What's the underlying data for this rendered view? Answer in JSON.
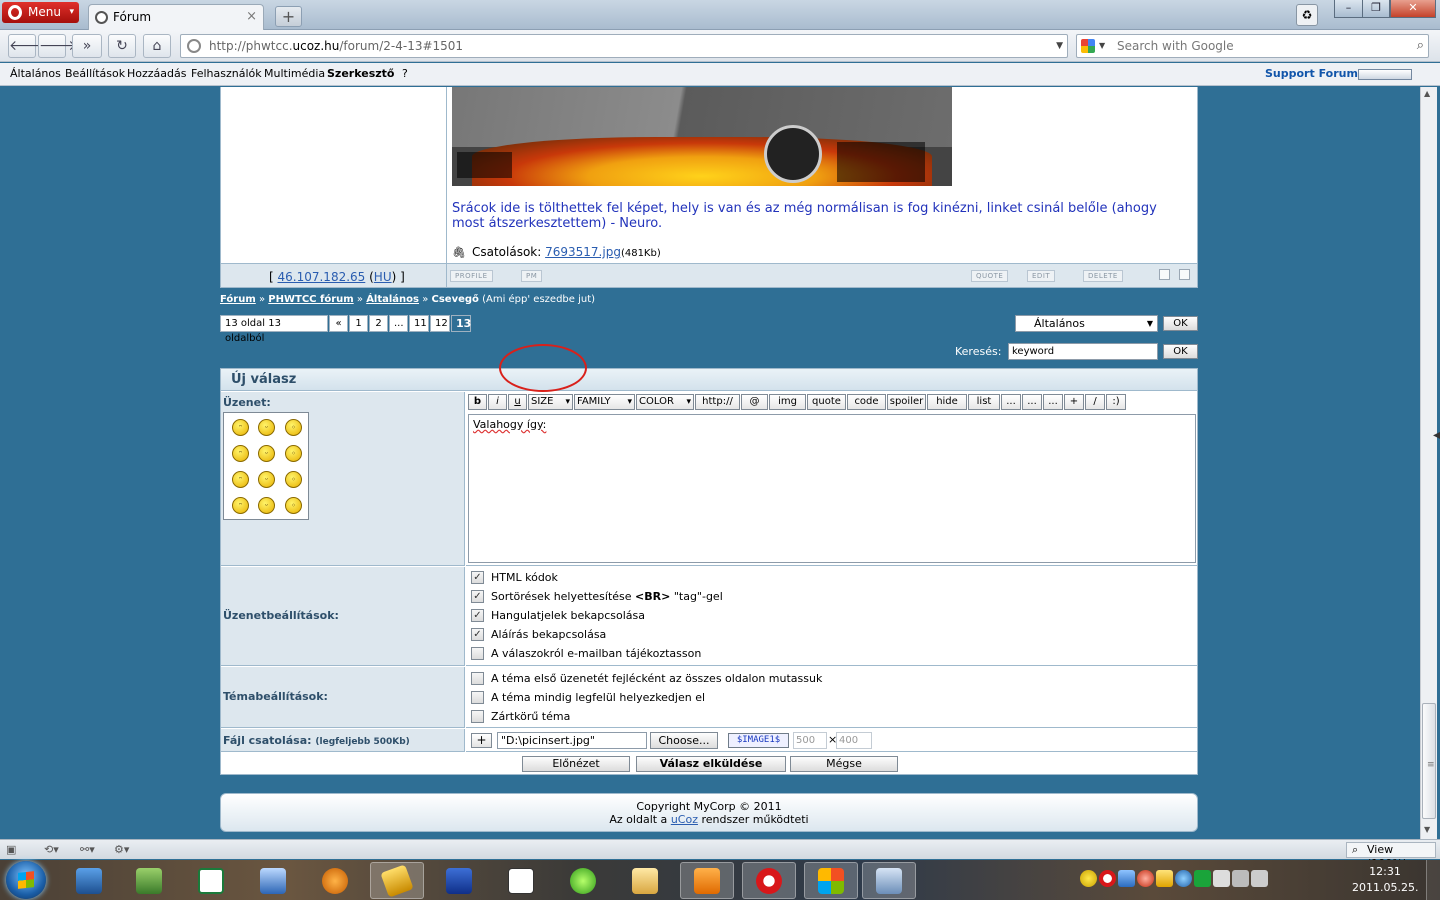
{
  "browser": {
    "menu_label": "Menu",
    "tab_title": "Fórum",
    "tab_close": "×",
    "new_tab": "+",
    "address_prefix": "http://phwtcc.",
    "address_domain": "ucoz.hu",
    "address_path": "/forum/2-4-13#1501",
    "search_placeholder": "Search with Google",
    "bookmarks": [
      "Általános",
      "Beállítások",
      "Hozzáadás",
      "Felhasználók",
      "Multimédia",
      "Szerkesztő",
      "?"
    ],
    "support_link": "Support Forum",
    "zoom": "View (100%)"
  },
  "post": {
    "text": "Srácok ide is tölthettek fel képet, hely is van és az még normálisan is fog kinézni, linket csinál belőle (ahogy most átszerkesztettem) - Neuro.",
    "attach_label": "Csatolások:",
    "attach_file": "7693517.jpg",
    "attach_size": "(481Kb)",
    "ip_open": "[ ",
    "ip": "46.107.182.65",
    "ip_country": "HU",
    "ip_close": " ]",
    "buttons": {
      "profile": "PROFILE",
      "pm": "PM",
      "quote": "QUOTE",
      "edit": "EDIT",
      "delete": "DELETE"
    }
  },
  "breadcrumb": {
    "forum": "Fórum",
    "section": "PHWTCC fórum",
    "category": "Általános",
    "topic": "Csevegő",
    "topic_desc": "(Ami épp' eszedbe jut)",
    "sep": "»"
  },
  "pager": {
    "summary": "13 oldal 13 oldalból",
    "prev": "«",
    "pages": [
      "1",
      "2",
      "...",
      "11",
      "12"
    ],
    "current": "13"
  },
  "jump": {
    "selected": "Általános",
    "ok": "OK"
  },
  "search": {
    "label": "Keresés:",
    "value": "keyword",
    "ok": "OK"
  },
  "reply": {
    "title": "Új válasz",
    "message_label": "Üzenet:",
    "toolbar": [
      "b",
      "i",
      "u",
      "SIZE",
      "FAMILY",
      "COLOR",
      "http://",
      "@",
      "img",
      "quote",
      "code",
      "spoiler",
      "hide",
      "list",
      "...",
      "...",
      "...",
      "+",
      "/",
      ":)"
    ],
    "message_text": "Valahogy így:",
    "settings_label": "Üzenetbeállítások:",
    "settings": [
      {
        "label_pre": "HTML kódok",
        "label_bold": "",
        "label_post": "",
        "checked": true
      },
      {
        "label_pre": "Sortörések helyettesítése ",
        "label_bold": "<BR>",
        "label_post": " \"tag\"-gel",
        "checked": true
      },
      {
        "label_pre": "Hangulatjelek bekapcsolása",
        "label_bold": "",
        "label_post": "",
        "checked": true
      },
      {
        "label_pre": "Aláírás bekapcsolása",
        "label_bold": "",
        "label_post": "",
        "checked": true
      },
      {
        "label_pre": "A válaszokról e-mailban tájékoztasson",
        "label_bold": "",
        "label_post": "",
        "checked": false
      }
    ],
    "topic_label": "Témabeállítások:",
    "topic_settings": [
      {
        "label": "A téma első üzenetét fejlécként az összes oldalon mutassuk",
        "checked": false
      },
      {
        "label": "A téma mindig legfelül helyezkedjen el",
        "checked": false
      },
      {
        "label": "Zártkörű téma",
        "checked": false
      }
    ],
    "file_label": "Fájl csatolása:",
    "file_limit": "(legfeljebb 500Kb)",
    "file_add": "+",
    "file_path": "\"D:\\picinsert.jpg\"",
    "choose": "Choose...",
    "image_code": "$IMAGE1$",
    "width": "500",
    "times": "×",
    "height": "400",
    "preview": "Előnézet",
    "submit": "Válasz elküldése",
    "cancel": "Mégse"
  },
  "footer": {
    "copyright": "Copyright MyCorp © 2011",
    "powered_pre": "Az oldalt a ",
    "powered_link": "uCoz",
    "powered_post": " rendszer működteti"
  },
  "taskbar": {
    "clock_time": "12:31",
    "clock_date": "2011.05.25."
  }
}
